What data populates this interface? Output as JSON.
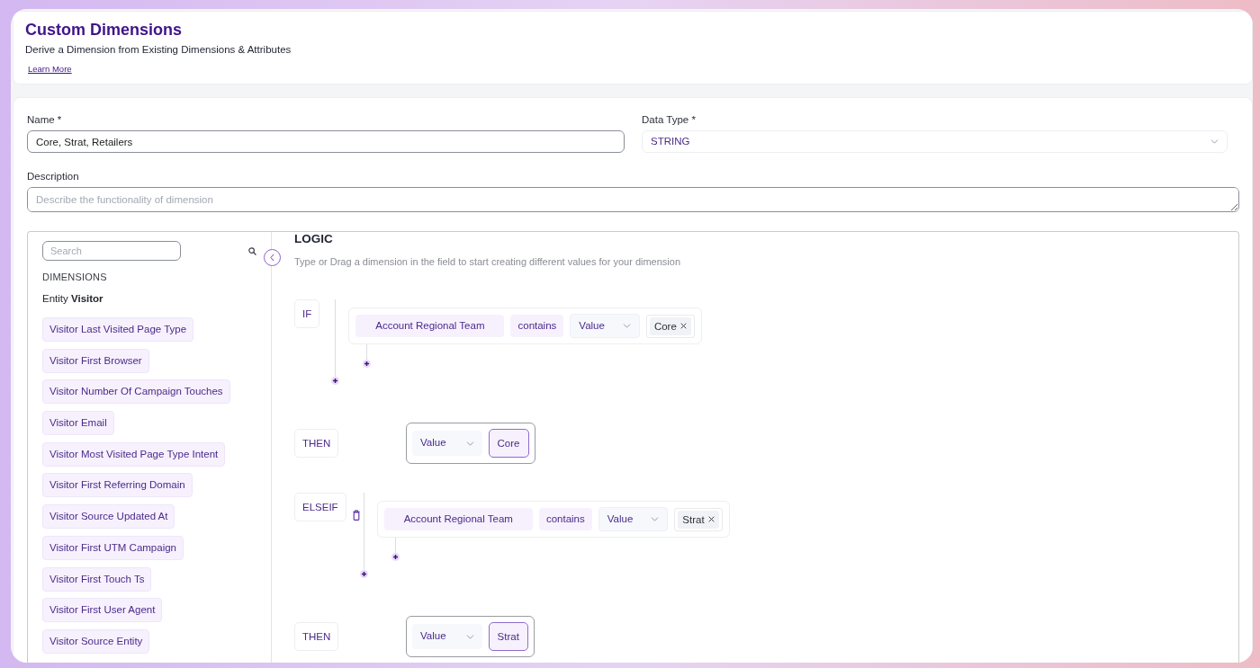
{
  "header": {
    "title": "Custom Dimensions",
    "subtitle": "Derive a Dimension from Existing Dimensions & Attributes",
    "link": "Learn More"
  },
  "form": {
    "name": {
      "label": "Name *",
      "value": "Core, Strat, Retailers"
    },
    "data_type": {
      "label": "Data Type *",
      "value": "STRING"
    },
    "description": {
      "label": "Description",
      "placeholder": "Describe the functionality of dimension"
    }
  },
  "dimensions_panel": {
    "search": {
      "placeholder": "Search"
    },
    "heading": "DIMENSIONS",
    "entity": "Entity **Visitor**",
    "items": [
      "Visitor Last Visited Page Type",
      "Visitor First Browser",
      "Visitor Number Of Campaign Touches",
      "Visitor Email",
      "Visitor Most Visited Page Type Intent",
      "Visitor First Referring Domain",
      "Visitor Source Updated At",
      "Visitor First UTM Campaign",
      "Visitor First Touch Ts",
      "Visitor First User Agent",
      "Visitor Source Entity"
    ]
  },
  "logic": {
    "title": "LOGIC",
    "hint": "Type or Drag a dimension in the field to start creating different values for your dimension",
    "blocks": [
      {
        "kind": "condition",
        "keyword": "IF",
        "deletable": false,
        "conditions": [
          {
            "field": "Account Regional Team",
            "operator": "contains",
            "value_type": "Value",
            "values": [
              "Core"
            ]
          }
        ]
      },
      {
        "kind": "result",
        "keyword": "THEN",
        "value_type": "Value",
        "value": "Core"
      },
      {
        "kind": "condition",
        "keyword": "ELSEIF",
        "deletable": true,
        "conditions": [
          {
            "field": "Account Regional Team",
            "operator": "contains",
            "value_type": "Value",
            "values": [
              "Strat"
            ]
          }
        ]
      },
      {
        "kind": "result",
        "keyword": "THEN",
        "value_type": "Value",
        "value": "Strat"
      }
    ]
  }
}
